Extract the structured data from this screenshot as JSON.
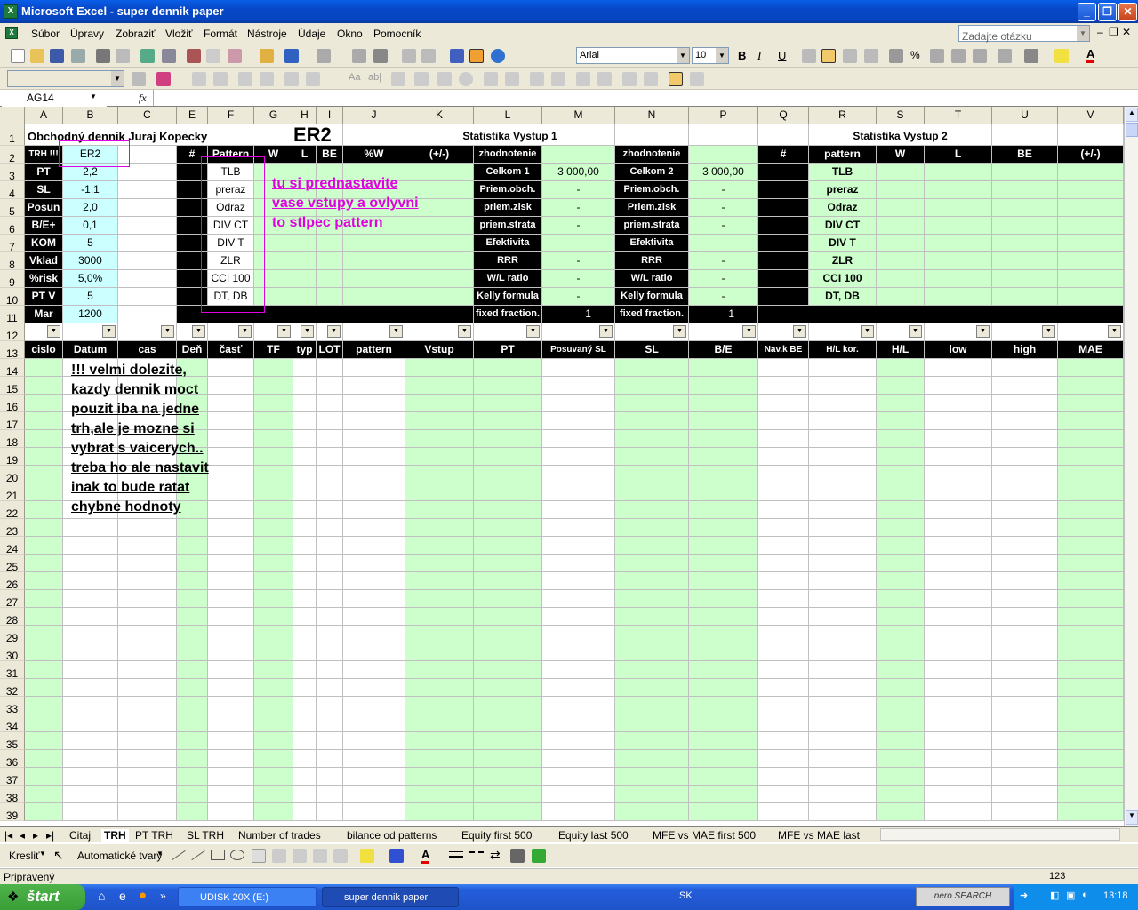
{
  "window": {
    "title": "Microsoft Excel - super dennik paper",
    "icon": "excel-icon"
  },
  "menu": {
    "items": [
      "Súbor",
      "Úpravy",
      "Zobraziť",
      "Vložiť",
      "Formát",
      "Nástroje",
      "Údaje",
      "Okno",
      "Pomocník"
    ],
    "help_placeholder": "Zadajte otázku"
  },
  "toolbar": {
    "font": "Arial",
    "size": "10"
  },
  "formula_bar": {
    "name_box": "AG14",
    "fx": "fx"
  },
  "columns": [
    "A",
    "B",
    "C",
    "E",
    "F",
    "G",
    "H",
    "I",
    "J",
    "K",
    "L",
    "M",
    "N",
    "P",
    "Q",
    "R",
    "S",
    "T",
    "U",
    "V"
  ],
  "rows": [
    "1",
    "2",
    "3",
    "4",
    "5",
    "6",
    "7",
    "8",
    "9",
    "10",
    "11",
    "12",
    "13",
    "14",
    "15",
    "16",
    "17",
    "18",
    "19",
    "20",
    "21",
    "22",
    "23",
    "24",
    "25",
    "26",
    "27",
    "28",
    "29",
    "30",
    "31",
    "32",
    "33",
    "34",
    "35",
    "36",
    "37",
    "38",
    "39"
  ],
  "sheet": {
    "title": "Obchodný dennik Juraj Kopecky",
    "title_big": "ER2",
    "stat1": "Statistika Vystup 1",
    "stat2": "Statistika Vystup 2",
    "params": [
      [
        "TRH !!!",
        "ER2"
      ],
      [
        "PT",
        "2,2"
      ],
      [
        "SL",
        "-1,1"
      ],
      [
        "Posun",
        "2,0"
      ],
      [
        "B/E+",
        "0,1"
      ],
      [
        "KOM",
        "5"
      ],
      [
        "Vklad",
        "3000"
      ],
      [
        "%risk",
        "5,0%"
      ],
      [
        "PT V",
        "5"
      ],
      [
        "Mar",
        "1200"
      ]
    ],
    "pattern_header": [
      "#",
      "Pattern",
      "W",
      "L",
      "BE",
      "%W",
      "(+/-)"
    ],
    "patterns": [
      "TLB",
      "preraz",
      "Odraz",
      "DIV CT",
      "DIV T",
      "ZLR",
      "CCI 100",
      "DT, DB"
    ],
    "stat_labels": [
      "zhodnotenie",
      "Celkom 1",
      "Priem.obch.",
      "priem.zisk",
      "priem.strata",
      "Efektivita",
      "RRR",
      "W/L ratio",
      "Kelly formula",
      "fixed fraction."
    ],
    "stat_labels2": [
      "zhodnotenie",
      "Celkom 2",
      "Priem.obch.",
      "Priem.zisk",
      "priem.strata",
      "Efektivita",
      "RRR",
      "W/L ratio",
      "Kelly formula",
      "fixed fraction."
    ],
    "stat_vals1": [
      "",
      "3 000,00",
      "-",
      "-",
      "-",
      "",
      "-",
      "-",
      "-",
      "1"
    ],
    "stat_vals2": [
      "",
      "3 000,00",
      "-",
      "-",
      "-",
      "",
      "-",
      "-",
      "-",
      "1"
    ],
    "pattern_header2": [
      "#",
      "pattern",
      "W",
      "L",
      "BE",
      "(+/-)"
    ],
    "headers13": [
      "cislo",
      "Datum",
      "cas",
      "Deň",
      "časť",
      "TF",
      "typ",
      "LOT",
      "pattern",
      "Vstup",
      "PT",
      "Posuvaný SL",
      "SL",
      "B/E",
      "Nav.k BE",
      "H/L kor.",
      "H/L",
      "low",
      "high",
      "MAE"
    ],
    "note_pink": [
      "tu si prednastavite",
      "vase vstupy a ovlyvni",
      "to stlpec pattern"
    ],
    "note_black": [
      "!!! velmi dolezite,",
      "kazdy dennik moct",
      "pouzit iba na jedne",
      "trh,ale je mozne si",
      "vybrat s vaicerych..",
      "treba ho ale nastavit",
      "inak to bude ratat",
      "chybne hodnoty"
    ]
  },
  "tabs": [
    "Citaj",
    "TRH",
    "PT TRH",
    "SL TRH",
    "Number of trades",
    "bilance od patterns",
    "Equity first 500",
    "Equity last 500",
    "MFE vs MAE first 500",
    "MFE vs MAE last"
  ],
  "drawbar": {
    "draw": "Kresliť",
    "shapes": "Automatické tvary"
  },
  "status": {
    "text": "Pripravený",
    "num": "123"
  },
  "taskbar": {
    "start": "štart",
    "tasks": [
      "UDISK 20X (E:)",
      "super dennik paper"
    ],
    "lang": "SK",
    "clock": "13:18",
    "nero": "nero SEARCH"
  }
}
